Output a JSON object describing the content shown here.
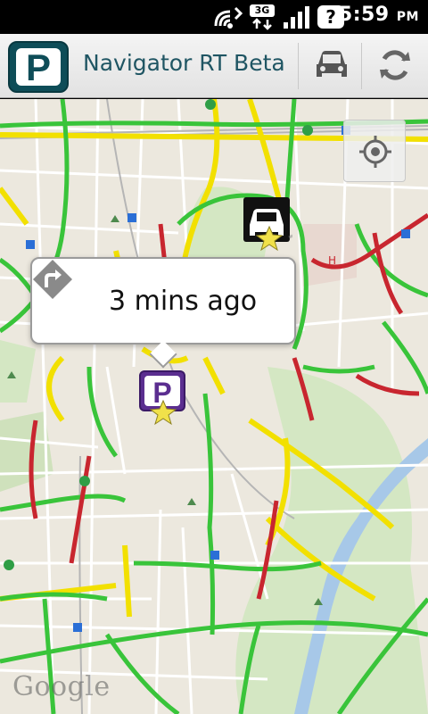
{
  "status_bar": {
    "time": "5:59",
    "am_pm": "PM",
    "network_label": "3G",
    "help_glyph": "?",
    "icons": [
      "wifi-signal-icon",
      "3g-data-icon",
      "cell-signal-icon",
      "help-icon"
    ]
  },
  "action_bar": {
    "logo_letter": "P",
    "title": "Navigator RT Beta",
    "buttons": [
      "car-icon",
      "refresh-icon"
    ]
  },
  "map": {
    "popup_text": "3 mins ago",
    "parking_marker_letter": "P",
    "attribution": "Google",
    "colors": {
      "traffic_green": "#39c43a",
      "traffic_yellow": "#f2e000",
      "traffic_red": "#c8262f",
      "road_white": "#ffffff",
      "park_green": "#d4e7c3",
      "water_blue": "#a7c8e8",
      "parking_purple": "#5b2e90",
      "header_teal": "#0e4d58"
    }
  }
}
